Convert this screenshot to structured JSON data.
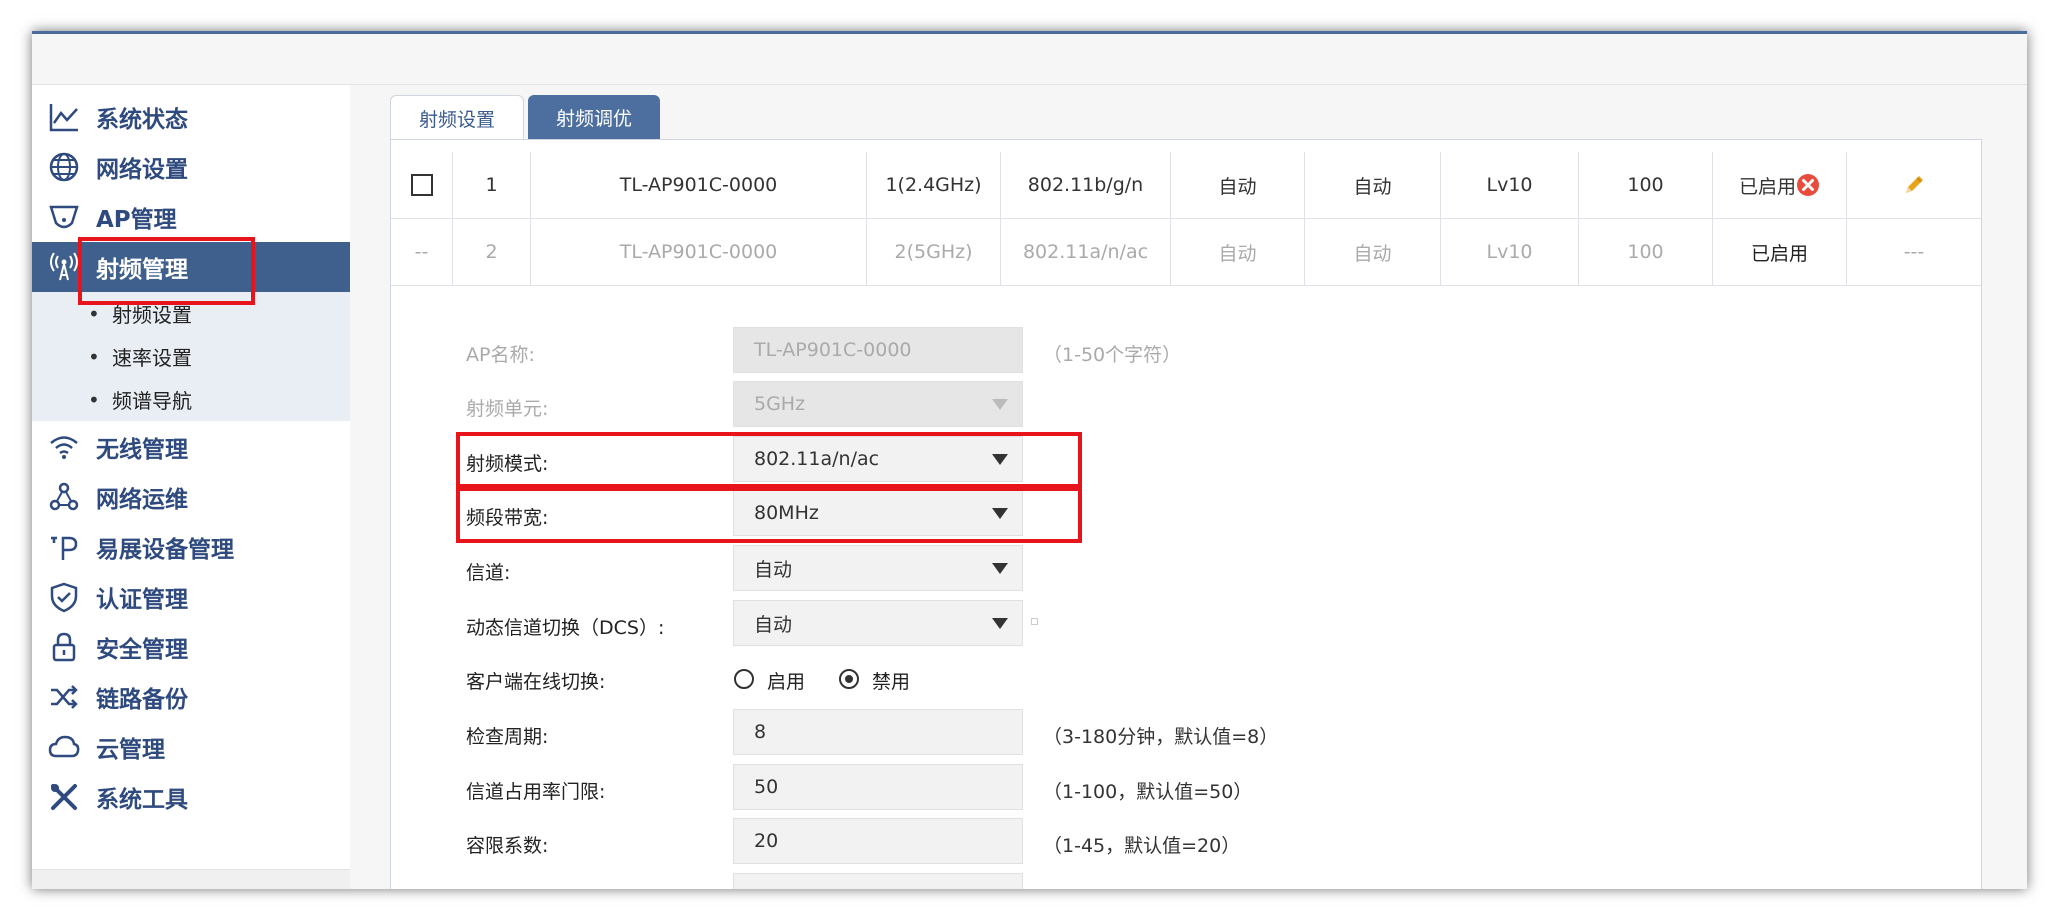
{
  "sidebar": {
    "items": [
      {
        "label": "系统状态",
        "icon": "chart-line-icon"
      },
      {
        "label": "网络设置",
        "icon": "globe-icon"
      },
      {
        "label": "AP管理",
        "icon": "ap-shield-icon"
      },
      {
        "label": "射频管理",
        "icon": "antenna-icon",
        "active": true
      },
      {
        "label": "无线管理",
        "icon": "wifi-icon"
      },
      {
        "label": "网络运维",
        "icon": "network-nodes-icon"
      },
      {
        "label": "易展设备管理",
        "icon": "easy-mesh-icon"
      },
      {
        "label": "认证管理",
        "icon": "shield-check-icon"
      },
      {
        "label": "安全管理",
        "icon": "lock-icon"
      },
      {
        "label": "链路备份",
        "icon": "shuffle-icon"
      },
      {
        "label": "云管理",
        "icon": "cloud-icon"
      },
      {
        "label": "系统工具",
        "icon": "tools-icon"
      }
    ],
    "subitems": [
      {
        "label": "射频设置"
      },
      {
        "label": "速率设置"
      },
      {
        "label": "频谱导航"
      }
    ]
  },
  "tabs": [
    {
      "label": "射频设置",
      "active": true
    },
    {
      "label": "射频调优",
      "active": false
    }
  ],
  "table": {
    "rows": [
      {
        "check": "",
        "index": "1",
        "name": "TL-AP901C-0000",
        "band": "1(2.4GHz)",
        "mode": "802.11b/g/n",
        "channel": "自动",
        "width": "自动",
        "power": "Lv10",
        "percent": "100",
        "status": "已启用",
        "action": "edit-pencil-icon"
      },
      {
        "check": "--",
        "index": "2",
        "name": "TL-AP901C-0000",
        "band": "2(5GHz)",
        "mode": "802.11a/n/ac",
        "channel": "自动",
        "width": "自动",
        "power": "Lv10",
        "percent": "100",
        "status": "已启用",
        "action": "---"
      }
    ]
  },
  "form": {
    "ap_name": {
      "label": "AP名称:",
      "value": "TL-AP901C-0000",
      "hint": "（1-50个字符）"
    },
    "radio_unit": {
      "label": "射频单元:",
      "value": "5GHz"
    },
    "radio_mode": {
      "label": "射频模式:",
      "value": "802.11a/n/ac"
    },
    "bandwidth": {
      "label": "频段带宽:",
      "value": "80MHz"
    },
    "channel": {
      "label": "信道:",
      "value": "自动"
    },
    "dcs": {
      "label": "动态信道切换（DCS）:",
      "value": "自动"
    },
    "client_switch": {
      "label": "客户端在线切换:",
      "option_on": "启用",
      "option_off": "禁用",
      "selected": "禁用"
    },
    "check_period": {
      "label": "检查周期:",
      "value": "8",
      "hint": "（3-180分钟，默认值=8）"
    },
    "channel_threshold": {
      "label": "信道占用率门限:",
      "value": "50",
      "hint": "（1-100，默认值=50）"
    },
    "tolerance": {
      "label": "容限系数:",
      "value": "20",
      "hint": "（1-45，默认值=20）"
    }
  },
  "colors": {
    "accent": "#3f5f8c",
    "highlight": "#e8141b",
    "tab_inactive": "#4c6f9f"
  }
}
